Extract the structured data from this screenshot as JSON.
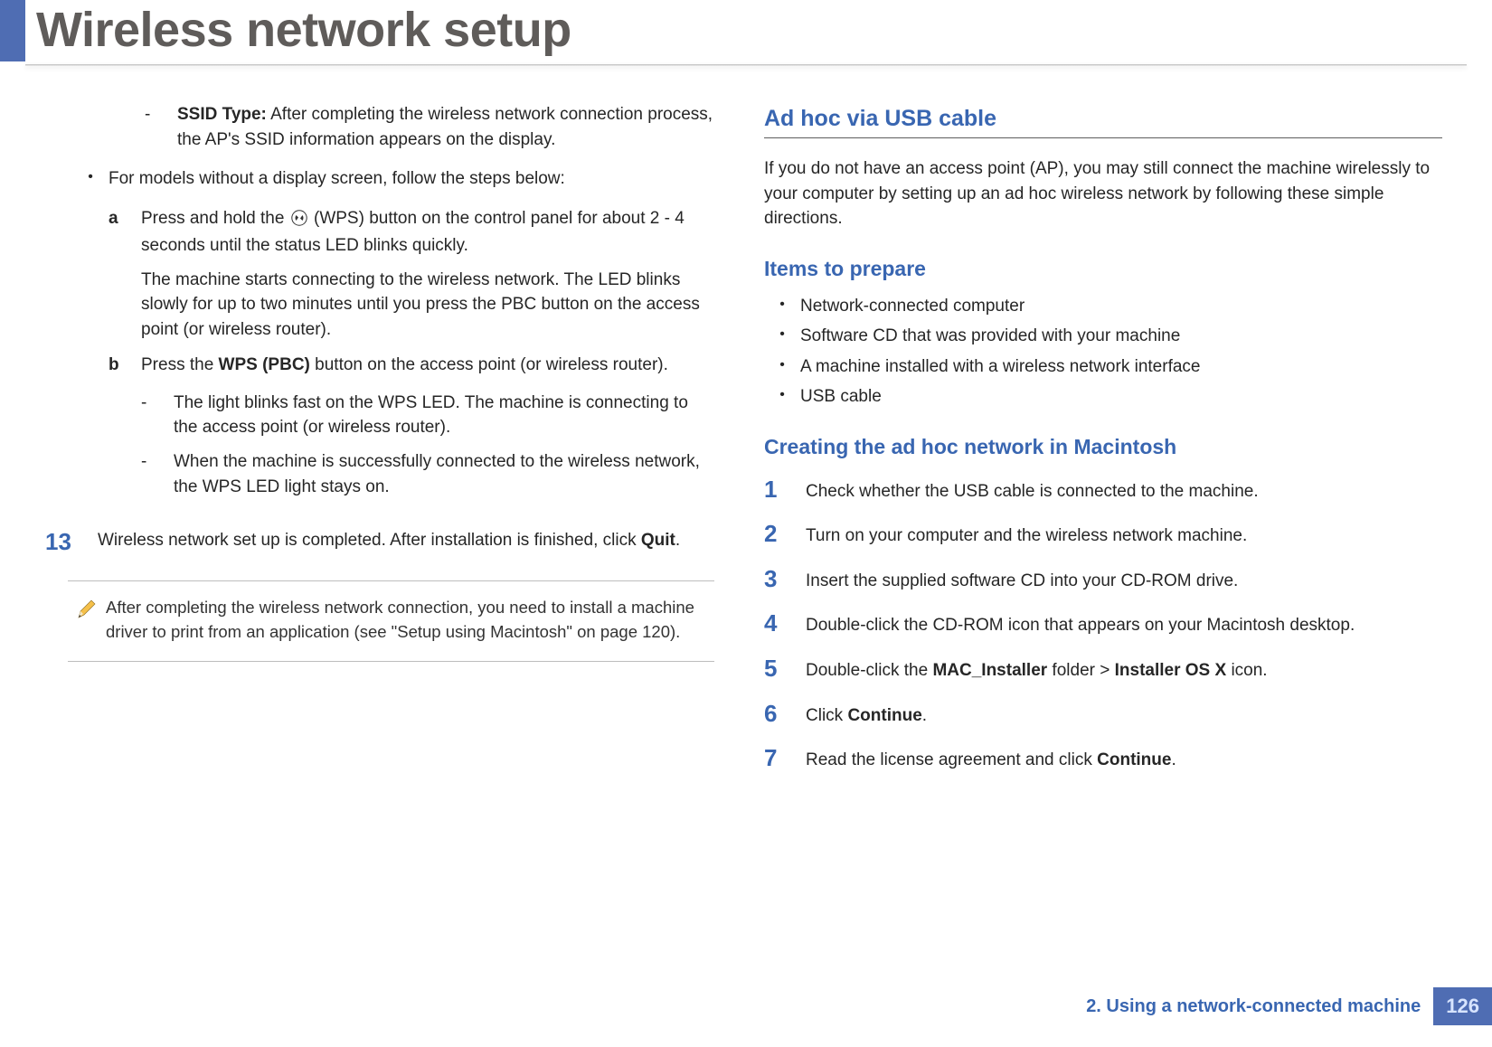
{
  "title": "Wireless network setup",
  "left": {
    "ssid_label": "SSID Type:",
    "ssid_text": " After completing the wireless network connection process, the AP's SSID information appears on the display.",
    "no_display_bullet": "For models without a display screen, follow the steps below:",
    "step_a_label": "a",
    "step_a_line1": "Press and hold the ",
    "step_a_line1_tail": " (WPS) button on the control panel for about 2 - 4 seconds until the status LED blinks quickly.",
    "step_a_line2": "The machine starts connecting to the wireless network. The LED blinks slowly for up to two minutes until you press the PBC button on the access point (or wireless router).",
    "step_b_label": "b",
    "step_b_pre": "Press the ",
    "step_b_bold": "WPS (PBC)",
    "step_b_post": " button on the access point (or wireless router).",
    "b_sub1": "The light blinks fast on the WPS LED. The machine is connecting to the access point (or wireless router).",
    "b_sub2": "When the machine is successfully connected to the wireless network, the WPS LED light stays on.",
    "step13_num": "13",
    "step13_pre": "Wireless network set up is completed. After installation is finished, click ",
    "step13_bold": "Quit",
    "step13_post": ".",
    "note": "After completing the wireless network connection, you need to install a machine driver to print from an application (see \"Setup using Macintosh\" on page 120)."
  },
  "right": {
    "section_title": "Ad hoc via USB cable",
    "intro": "If you do not have an access point (AP), you may still connect the machine wirelessly to your computer by setting up an ad hoc wireless network by following these simple directions.",
    "prepare_head": "Items to prepare",
    "prepare": [
      "Network-connected computer",
      "Software CD that was provided with your machine",
      "A machine installed with a wireless network interface",
      "USB cable"
    ],
    "create_head": "Creating the ad hoc network in Macintosh",
    "steps": {
      "s1": "Check whether the USB cable is connected to the machine.",
      "s2": "Turn on your computer and the wireless network machine.",
      "s3": "Insert the supplied software CD into your CD-ROM drive.",
      "s4": "Double-click the CD-ROM icon that appears on your Macintosh desktop.",
      "s5_pre": "Double-click the ",
      "s5_b1": "MAC_Installer",
      "s5_mid": " folder > ",
      "s5_b2": "Installer OS X",
      "s5_post": " icon.",
      "s6_pre": "Click ",
      "s6_b": "Continue",
      "s6_post": ".",
      "s7_pre": "Read the license agreement and click ",
      "s7_b": "Continue",
      "s7_post": "."
    }
  },
  "footer": {
    "chapter": "2.  Using a network-connected machine",
    "page": "126"
  }
}
